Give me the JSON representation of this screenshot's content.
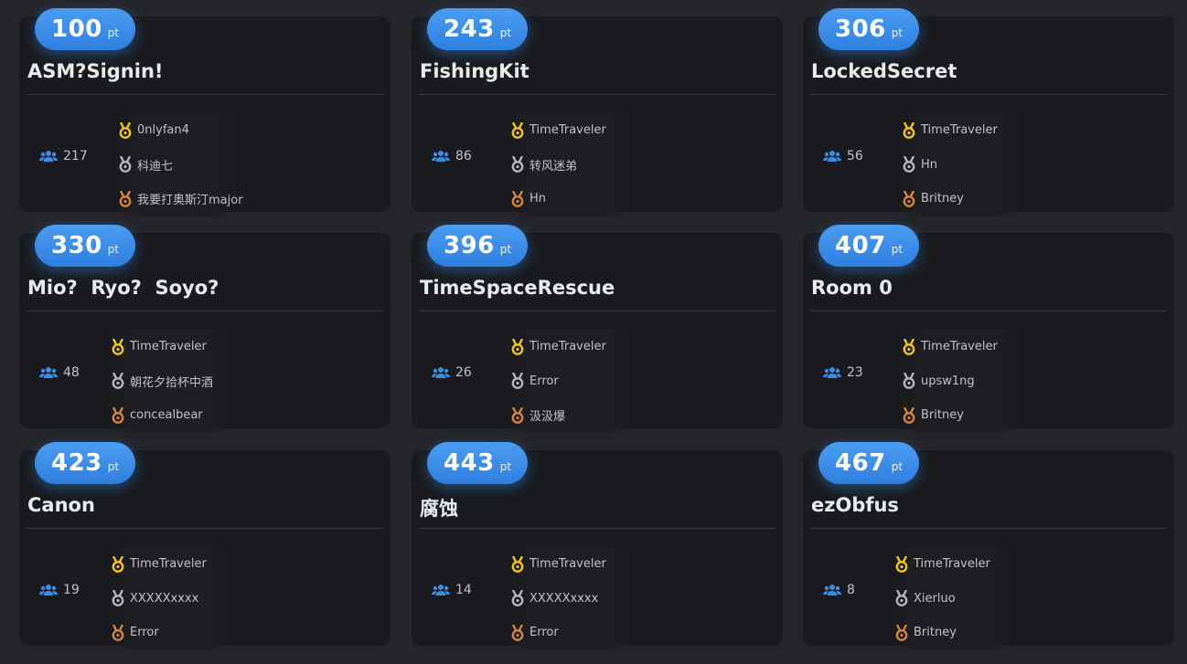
{
  "colors": {
    "background": "#25262b",
    "card": "#1a1b1e",
    "accent": "#3a8ee6",
    "gold": "#f5c518",
    "silver": "#b5b7ba",
    "bronze": "#d8843a"
  },
  "unit_label": "pt",
  "cards": [
    {
      "points": "100",
      "title": "ASM?Signin!",
      "solves": "217",
      "ranks": [
        "0nlyfan4",
        "科迪七",
        "我要打奥斯汀major"
      ]
    },
    {
      "points": "243",
      "title": "FishingKit",
      "solves": "86",
      "ranks": [
        "TimeTraveler",
        "转风迷弟",
        "Hn"
      ]
    },
    {
      "points": "306",
      "title": "LockedSecret",
      "solves": "56",
      "ranks": [
        "TimeTraveler",
        "Hn",
        "Britney"
      ]
    },
    {
      "points": "330",
      "title": "Mio?  Ryo?  Soyo?",
      "solves": "48",
      "ranks": [
        "TimeTraveler",
        "朝花夕拾杯中酒",
        "concealbear"
      ]
    },
    {
      "points": "396",
      "title": "TimeSpaceRescue",
      "solves": "26",
      "ranks": [
        "TimeTraveler",
        "Error",
        "汲汲爆"
      ]
    },
    {
      "points": "407",
      "title": "Room 0",
      "solves": "23",
      "ranks": [
        "TimeTraveler",
        "upsw1ng",
        "Britney"
      ]
    },
    {
      "points": "423",
      "title": "Canon",
      "solves": "19",
      "ranks": [
        "TimeTraveler",
        "XXXXXxxxx",
        "Error"
      ]
    },
    {
      "points": "443",
      "title": "腐蚀",
      "solves": "14",
      "ranks": [
        "TimeTraveler",
        "XXXXXxxxx",
        "Error"
      ]
    },
    {
      "points": "467",
      "title": "ezObfus",
      "solves": "8",
      "ranks": [
        "TimeTraveler",
        "Xierluo",
        "Britney"
      ]
    }
  ],
  "icons": {
    "solves": "users-icon",
    "rank_1": "gold-medal-icon",
    "rank_2": "silver-medal-icon",
    "rank_3": "bronze-medal-icon"
  }
}
